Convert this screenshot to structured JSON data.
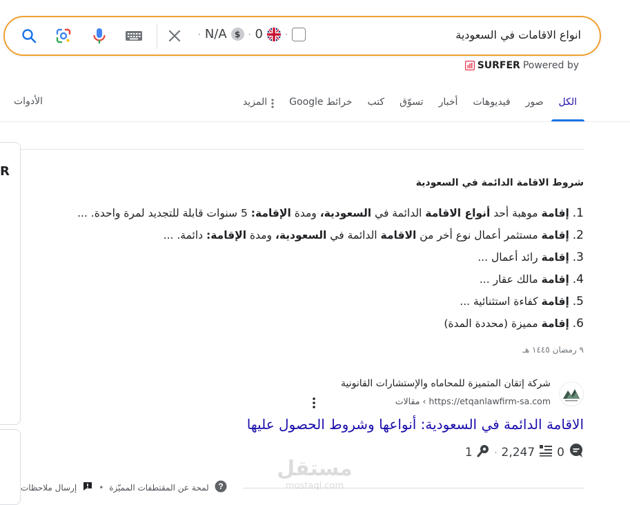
{
  "search": {
    "query": "انواع الاقامات في السعودية",
    "ext_na": "N/A",
    "ext_zero": "0",
    "dollar": "$"
  },
  "surfer": {
    "brand": "SURFER",
    "powered": "Powered by"
  },
  "tabs": [
    {
      "label": "الكل"
    },
    {
      "label": "صور"
    },
    {
      "label": "فيديوهات"
    },
    {
      "label": "أخبار"
    },
    {
      "label": "تسوّق"
    },
    {
      "label": "كتب"
    },
    {
      "label": "خرائط Google"
    },
    {
      "label": "المزيد"
    }
  ],
  "tools_label": "الأدوات",
  "left_panel_letter": "R",
  "snippet": {
    "title": "شروط الاقامة الدائمة في السعودية",
    "items": [
      {
        "n": "1.",
        "bold": "إقامة",
        "text": " موهبة أحد ",
        "bold2": "أنواع الاقامة",
        "text2": " الدائمة في ",
        "bold3": "السعودية،",
        "text3": " ومدة ",
        "bold4": "الإقامة:",
        "text4": " 5 سنوات قابلة للتجديد لمرة واحدة. ..."
      },
      {
        "n": "2.",
        "bold": "إقامة",
        "text": " مستثمر أعمال نوع أخر من ",
        "bold2": "الاقامة",
        "text2": " الدائمة في ",
        "bold3": "السعودية،",
        "text3": " ومدة ",
        "bold4": "الإقامة:",
        "text4": " دائمة. ..."
      },
      {
        "n": "3.",
        "bold": "إقامة",
        "text": " رائد أعمال ...",
        "bold2": "",
        "text2": "",
        "bold3": "",
        "text3": "",
        "bold4": "",
        "text4": ""
      },
      {
        "n": "4.",
        "bold": "إقامة",
        "text": " مالك عقار ...",
        "bold2": "",
        "text2": "",
        "bold3": "",
        "text3": "",
        "bold4": "",
        "text4": ""
      },
      {
        "n": "5.",
        "bold": "إقامة",
        "text": " كفاءة استثنائية ...",
        "bold2": "",
        "text2": "",
        "bold3": "",
        "text3": "",
        "bold4": "",
        "text4": ""
      },
      {
        "n": "6.",
        "bold": "إقامة",
        "text": " مميزة (محددة المدة)",
        "bold2": "",
        "text2": "",
        "bold3": "",
        "text3": "",
        "bold4": "",
        "text4": ""
      }
    ],
    "date": "٩ رمضان ١٤٤٥ هـ"
  },
  "result": {
    "site_name": "شركة إتقان المتميزة للمحاماه والإستشارات القانونية",
    "url": "https://etqanlawfirm-sa.com › مقالات",
    "title": "الاقامة الدائمة في السعودية: أنواعها وشروط الحصول عليها",
    "stat_comments": "0",
    "stat_words": "2,247",
    "stat_links": "1"
  },
  "footer": {
    "about": "لمحة عن المقتطفات المميّزة",
    "feedback": "إرسال ملاحظات"
  },
  "watermark": {
    "ar": "مستقل",
    "en": "mostaql.com"
  },
  "colors": {
    "searchbar_border": "#f0a030",
    "link": "#1a0dab",
    "active_tab_underline": "#1a73e8"
  }
}
